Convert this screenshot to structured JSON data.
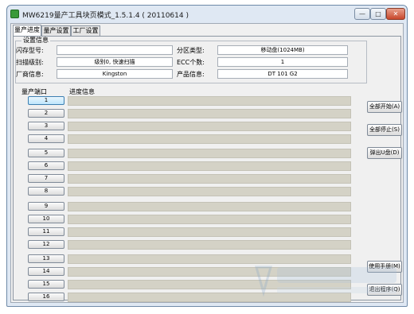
{
  "window": {
    "title": "MW6219量产工具块页模式_1.5.1.4 ( 20110614 )"
  },
  "titlebar_buttons": {
    "minimize": "—",
    "maximize": "□",
    "close": "✕"
  },
  "tabs": [
    "量产进度",
    "量产设置",
    "工厂设置"
  ],
  "settings": {
    "group_label": "设置信息",
    "flash_type_label": "闪存型号:",
    "flash_type_value": "",
    "partition_type_label": "分区类型:",
    "partition_type_value": "移动盘(1024MB)",
    "scan_level_label": "扫描级别:",
    "scan_level_value": "级别0, 快速扫描",
    "ecc_count_label": "ECC个数:",
    "ecc_count_value": "1",
    "vendor_label": "厂商信息:",
    "vendor_value": "Kingston",
    "product_label": "产品信息:",
    "product_value": "DT 101 G2"
  },
  "ports_header": "量产端口",
  "progress_header": "进度信息",
  "ports": [
    "1",
    "2",
    "3",
    "4",
    "5",
    "6",
    "7",
    "8",
    "9",
    "10",
    "11",
    "12",
    "13",
    "14",
    "15",
    "16"
  ],
  "buttons": {
    "start_all": "全部开始(A)",
    "stop_all": "全部停止(S)",
    "eject_u": "弹出U盘(D)",
    "manual": "使用手册(M)",
    "exit": "退出程序(Q)"
  }
}
